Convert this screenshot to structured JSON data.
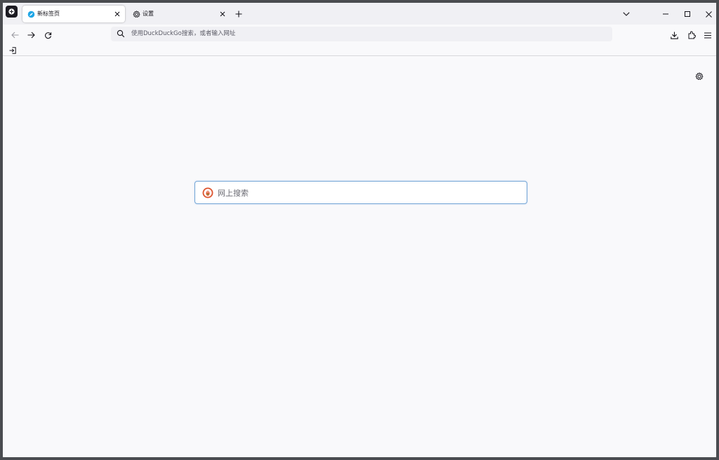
{
  "browser": {
    "tabs": [
      {
        "label": "新标签页",
        "active": true,
        "icon": "firefox-icon"
      },
      {
        "label": "设置",
        "active": false,
        "icon": "gear-icon"
      }
    ]
  },
  "navbar": {
    "url_placeholder": "使用DuckDuckGo搜索，或者输入网址"
  },
  "newtab": {
    "search_placeholder": "网上搜索",
    "search_engine": "DuckDuckGo"
  },
  "colors": {
    "accent": "#0060df",
    "search_border": "#76a7d6",
    "ddg_orange": "#de5833"
  }
}
